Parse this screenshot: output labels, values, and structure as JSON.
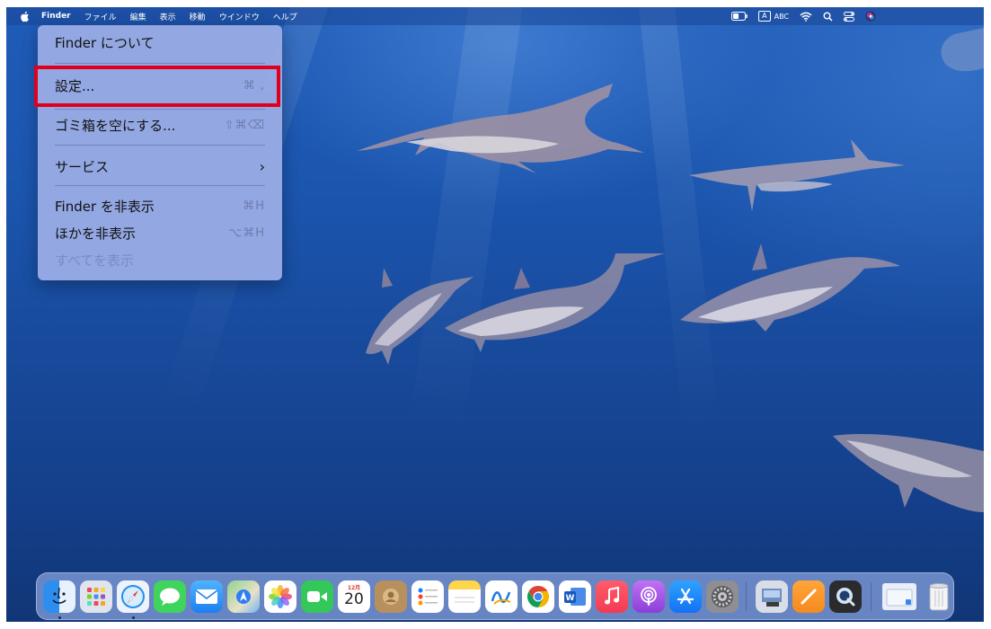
{
  "menubar": {
    "app_name": "Finder",
    "menus": [
      "ファイル",
      "編集",
      "表示",
      "移動",
      "ウインドウ",
      "ヘルプ"
    ],
    "status": {
      "input_indicator": "A",
      "input_mode": "ABC",
      "icons": [
        "battery-icon",
        "wifi-icon",
        "spotlight-search-icon",
        "control-center-icon",
        "siri-icon"
      ]
    }
  },
  "finder_menu": {
    "about": "Finder について",
    "settings": "設定...",
    "settings_shortcut": "⌘ ,",
    "empty_trash": "ゴミ箱を空にする...",
    "empty_trash_shortcut": "⇧⌘⌫",
    "services": "サービス",
    "services_arrow": "›",
    "hide_finder": "Finder を非表示",
    "hide_finder_shortcut": "⌘H",
    "hide_others": "ほかを非表示",
    "hide_others_shortcut": "⌥⌘H",
    "show_all": "すべてを表示",
    "highlight_color": "#e0001b"
  },
  "dock": {
    "calendar_month": "12月",
    "calendar_day": "20",
    "apps": [
      "Finder",
      "Launchpad",
      "Safari",
      "Messages",
      "Mail",
      "Maps",
      "Photos",
      "FaceTime",
      "Calendar",
      "Contacts",
      "Reminders",
      "Notes",
      "Freeform",
      "Chrome",
      "Word",
      "Music",
      "Podcasts",
      "App Store",
      "System Settings",
      "Preview",
      "Pages",
      "QuickTime",
      "Downloads",
      "Trash"
    ]
  }
}
